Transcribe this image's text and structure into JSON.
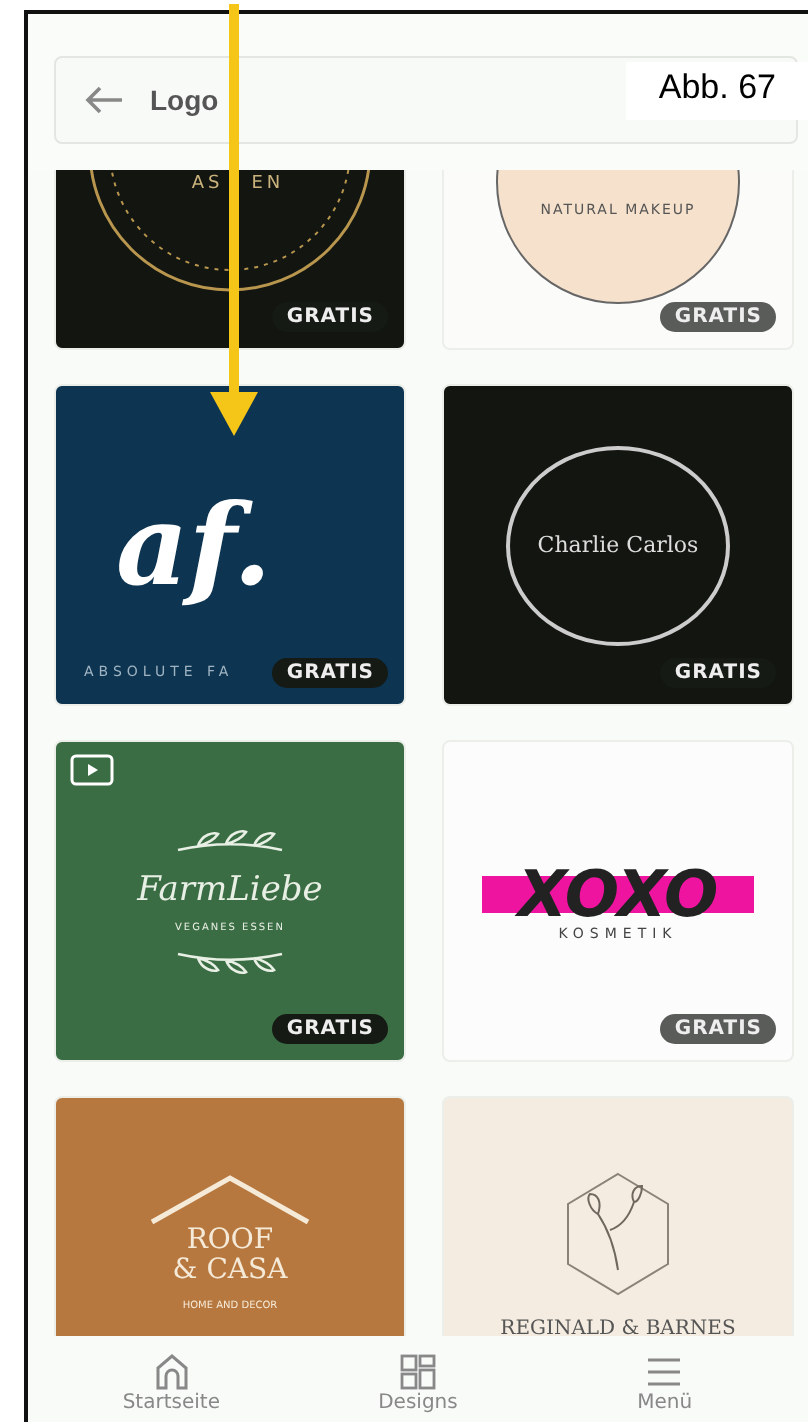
{
  "search": {
    "value": "Logo"
  },
  "figure_label": "Abb. 67",
  "cards": [
    {
      "kind": "asen",
      "texts": [
        "AS",
        "EN"
      ],
      "badge": "GRATIS",
      "video": false
    },
    {
      "kind": "jameela",
      "texts": [
        "NATURAL MAKEUP"
      ],
      "badge": "GRATIS",
      "video": false
    },
    {
      "kind": "af",
      "texts": [
        "af.",
        "ABSOLUTE FA"
      ],
      "badge": "GRATIS",
      "video": false
    },
    {
      "kind": "charlie",
      "texts": [
        "Charlie Carlos"
      ],
      "badge": "GRATIS",
      "video": false
    },
    {
      "kind": "farm",
      "texts": [
        "FarmLiebe",
        "VEGANES ESSEN"
      ],
      "badge": "GRATIS",
      "video": true
    },
    {
      "kind": "xoxo",
      "texts": [
        "XOXO",
        "KOSMETIK"
      ],
      "badge": "GRATIS",
      "video": false
    },
    {
      "kind": "roof",
      "texts": [
        "ROOF",
        "& CASA",
        "HOME AND DECOR"
      ],
      "video": false
    },
    {
      "kind": "reginald",
      "texts": [
        "REGINALD & BARNES"
      ],
      "video": false
    }
  ],
  "nav": [
    {
      "kind": "home",
      "label": "Startseite"
    },
    {
      "kind": "designs",
      "label": "Designs"
    },
    {
      "kind": "menu",
      "label": "Menü"
    }
  ]
}
